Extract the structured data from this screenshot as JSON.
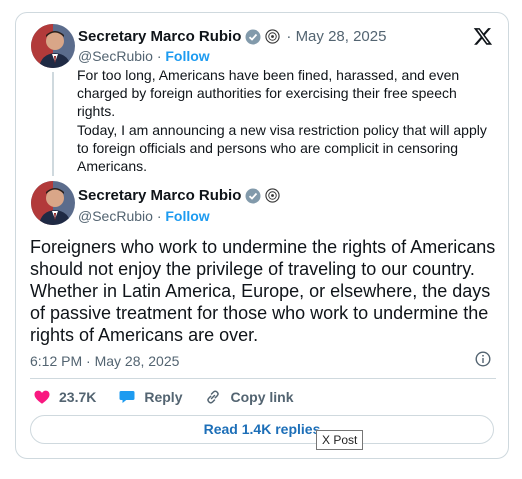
{
  "tweet_parent": {
    "author_name": "Secretary Marco Rubio",
    "handle": "@SecRubio",
    "separator": "·",
    "follow_label": "Follow",
    "date": "May 28, 2025",
    "paragraph_1": "For too long, Americans have been fined, harassed, and even charged by foreign authorities for exercising their free speech rights.",
    "paragraph_2": "Today, I am announcing a new visa restriction policy that will apply to foreign officials and persons who are complicit in censoring Americans."
  },
  "tweet_main": {
    "author_name": "Secretary Marco Rubio",
    "handle": "@SecRubio",
    "separator": "·",
    "follow_label": "Follow",
    "text": "Foreigners who work to undermine the rights of Americans should not enjoy the privilege of traveling to our country.  Whether in Latin America, Europe, or elsewhere, the days of passive treatment for those who work to undermine the rights of Americans are over.",
    "timestamp": "6:12 PM · May 28, 2025"
  },
  "actions": {
    "likes": "23.7K",
    "reply_label": "Reply",
    "copy_link_label": "Copy link"
  },
  "replies_button": "Read 1.4K replies",
  "tooltip": "X Post",
  "colors": {
    "accent": "#1d9bf0",
    "heart": "#f91880",
    "border": "#cfd9de",
    "muted": "#536471"
  },
  "icons": [
    "x-logo-icon",
    "verified-badge-icon",
    "government-seal-icon",
    "info-icon",
    "heart-icon",
    "reply-icon",
    "link-icon"
  ]
}
